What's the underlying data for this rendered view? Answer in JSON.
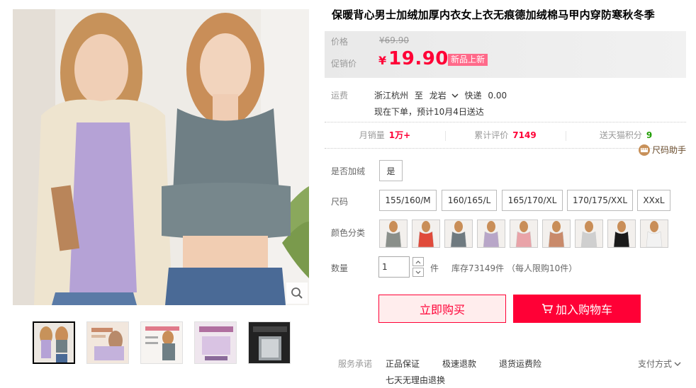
{
  "product": {
    "title": "保暖背心男士加绒加厚内衣女上衣无痕德加绒棉马甲内穿防寒秋冬季"
  },
  "price": {
    "price_label": "价格",
    "original_currency": "¥",
    "original_value": "69.90",
    "promo_label": "促销价",
    "promo_currency": "¥",
    "promo_value": "19.90",
    "badge": "新品上新"
  },
  "shipping": {
    "label": "运费",
    "from": "浙江杭州",
    "to_word": "至",
    "destination": "龙岩",
    "method": "快递",
    "fee": "0.00",
    "delivery_note": "现在下单，预计10月4日送达"
  },
  "stats": {
    "monthly_sales_label": "月销量",
    "monthly_sales_value": "1万+",
    "reviews_label": "累计评价",
    "reviews_value": "7149",
    "points_label": "送天猫积分",
    "points_value": "9"
  },
  "size_helper": {
    "label": "尺码助手"
  },
  "options": {
    "fleece_label": "是否加绒",
    "fleece_values": [
      "是"
    ],
    "size_label": "尺码",
    "sizes": [
      "155/160/M",
      "160/165/L",
      "165/170/XL",
      "170/175/XXL",
      "XXxL"
    ],
    "color_label": "颜色分类",
    "color_swatches": [
      "#8a8f8a",
      "#e04a3a",
      "#6f7a80",
      "#b8a6c8",
      "#e9a3a8",
      "#c98a6a",
      "#cfcfcf",
      "#1a1a1a",
      "#f2f2f2"
    ]
  },
  "quantity": {
    "label": "数量",
    "value": "1",
    "unit": "件",
    "stock_text": "库存73149件 （每人限购10件）"
  },
  "actions": {
    "buy_now": "立即购买",
    "add_cart": "加入购物车"
  },
  "services": {
    "label": "服务承诺",
    "items": [
      "正品保证",
      "极速退款",
      "退货运费险",
      "七天无理由退换"
    ],
    "payment": "支付方式"
  },
  "colors": {
    "accent_red": "#ff0036",
    "badge_pink": "#ff6a8a",
    "points_green": "#1f9d00"
  }
}
